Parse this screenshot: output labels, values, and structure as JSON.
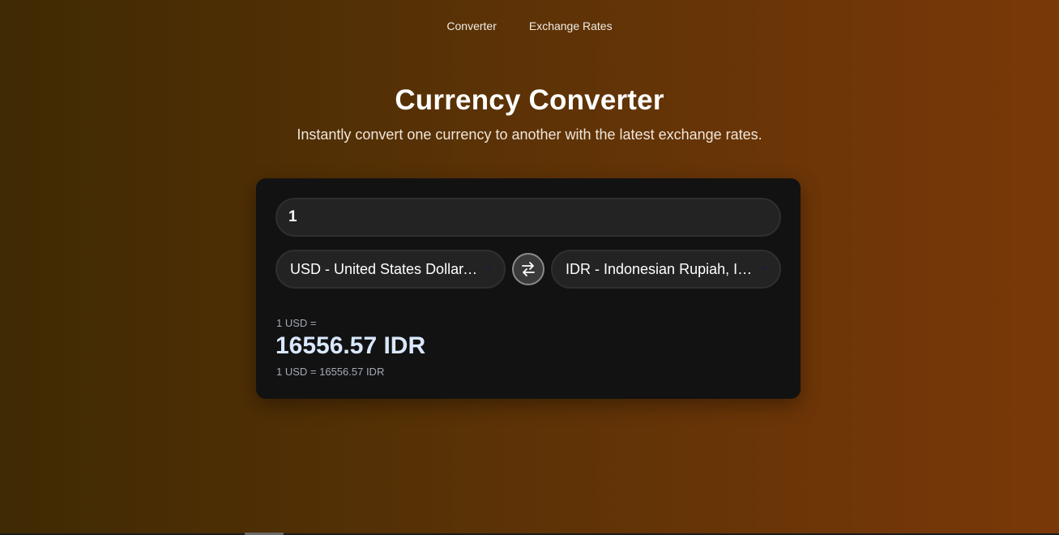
{
  "nav": {
    "items": [
      {
        "label": "Converter"
      },
      {
        "label": "Exchange Rates"
      }
    ]
  },
  "hero": {
    "title": "Currency Converter",
    "subtitle": "Instantly convert one currency to another with the latest exchange rates."
  },
  "converter": {
    "amount": "1",
    "from_currency": "USD - United States Dollar, ...",
    "to_currency": "IDR - Indonesian Rupiah, In...",
    "swap_icon": "swap-arrows-icon",
    "result_prefix": "1 USD =",
    "result_value": "16556.57 IDR",
    "rate_text": "1 USD = 16556.57 IDR"
  },
  "colors": {
    "background_start": "#3f2a03",
    "background_end": "#7a3808",
    "card": "#121212",
    "result_accent": "#d9e8ff"
  }
}
